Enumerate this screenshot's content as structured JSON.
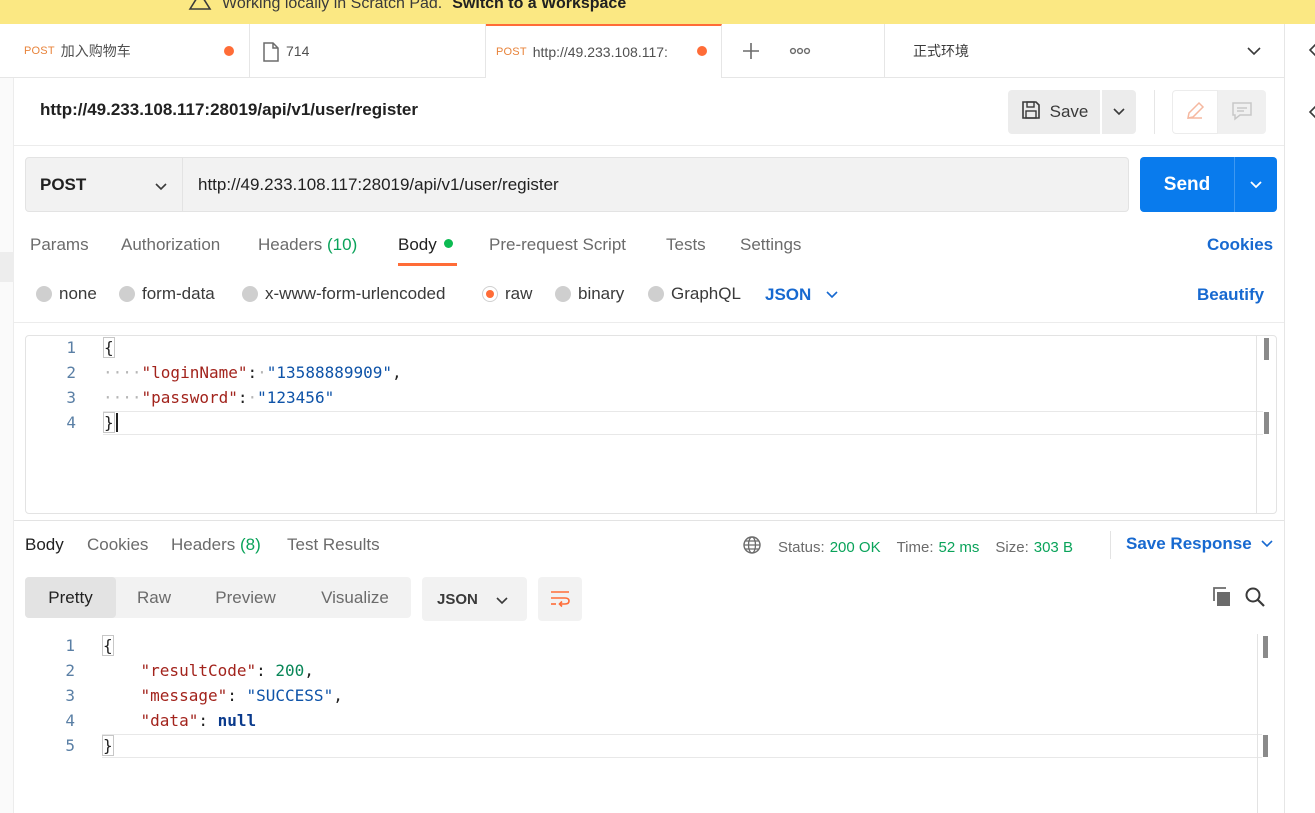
{
  "banner": {
    "text": "Working locally in Scratch Pad.",
    "link": "Switch to a Workspace"
  },
  "tabs": [
    {
      "method": "POST",
      "label": "加入购物车",
      "unsaved": true
    },
    {
      "label": "714"
    },
    {
      "method": "POST",
      "label": "http://49.233.108.117:",
      "unsaved": true,
      "active": true
    }
  ],
  "environment": {
    "label": "正式环境"
  },
  "request": {
    "title": "http://49.233.108.117:28019/api/v1/user/register",
    "save_label": "Save",
    "method": "POST",
    "url": "http://49.233.108.117:28019/api/v1/user/register",
    "send_label": "Send",
    "tabs": {
      "params": "Params",
      "authorization": "Authorization",
      "headers": "Headers",
      "headers_count": "(10)",
      "body": "Body",
      "prerequest": "Pre-request Script",
      "tests": "Tests",
      "settings": "Settings"
    },
    "cookies_label": "Cookies",
    "body_types": {
      "none": "none",
      "form_data": "form-data",
      "urlencoded": "x-www-form-urlencoded",
      "raw": "raw",
      "binary": "binary",
      "graphql": "GraphQL"
    },
    "selected_body_type": "raw",
    "format": "JSON",
    "beautify_label": "Beautify",
    "body_lines": {
      "l1": "1",
      "l2": "2",
      "l3": "3",
      "l4": "4",
      "open": "{",
      "key1": "\"loginName\"",
      "val1": "\"13588889909\"",
      "key2": "\"password\"",
      "val2": "\"123456\"",
      "close": "}"
    }
  },
  "response": {
    "tabs": {
      "body": "Body",
      "cookies": "Cookies",
      "headers": "Headers",
      "headers_count": "(8)",
      "test_results": "Test Results"
    },
    "status_label": "Status:",
    "status_value": "200 OK",
    "time_label": "Time:",
    "time_value": "52 ms",
    "size_label": "Size:",
    "size_value": "303 B",
    "save_label": "Save Response",
    "views": {
      "pretty": "Pretty",
      "raw": "Raw",
      "preview": "Preview",
      "visualize": "Visualize"
    },
    "format": "JSON",
    "body_lines": {
      "l1": "1",
      "l2": "2",
      "l3": "3",
      "l4": "4",
      "l5": "5",
      "open": "{",
      "key1": "\"resultCode\"",
      "val1": "200",
      "key2": "\"message\"",
      "val2": "\"SUCCESS\"",
      "key3": "\"data\"",
      "val3": "null",
      "close": "}"
    }
  },
  "colors": {
    "accent": "#ff6c37",
    "primary": "#097bed",
    "link": "#1769d0",
    "success": "#0aa35a",
    "banner": "#fbe883"
  },
  "icons": [
    "warning-icon",
    "request-doc-icon",
    "plus-icon",
    "more-icon",
    "chevron-down-icon",
    "save-icon",
    "pencil-icon",
    "comment-icon",
    "globe-icon",
    "wrap-lines-icon",
    "copy-icon",
    "search-icon"
  ]
}
